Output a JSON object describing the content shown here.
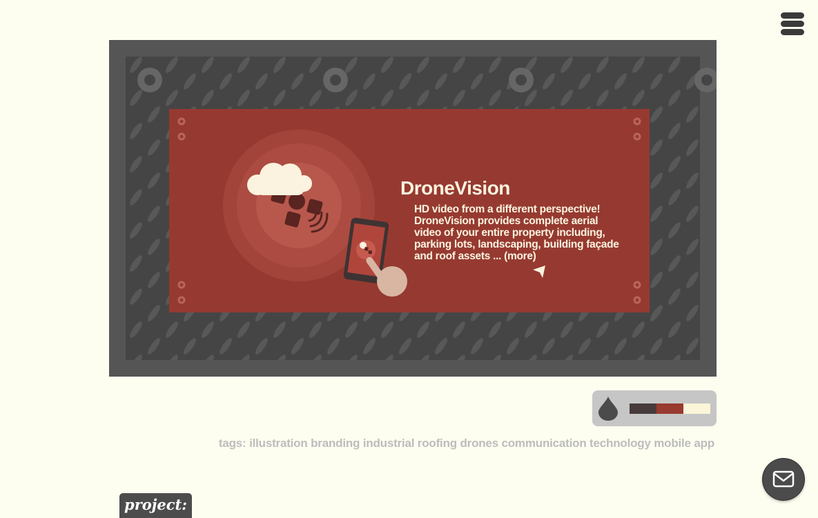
{
  "nav": {
    "menu_icon": "hamburger-icon"
  },
  "hero": {
    "title": "DroneVision",
    "description_lines": [
      "HD video from a different perspective!",
      "DroneVision provides complete aerial",
      "video of your entire property including,",
      "parking lots, landscaping, building façade",
      "and roof assets ... (more)"
    ],
    "colors": {
      "frame": "#555555",
      "plate": "#454545",
      "banner": "#963a31",
      "text": "#fbf3df"
    }
  },
  "palette": {
    "icon": "color-drop-icon",
    "swatches": [
      "#473c3b",
      "#983a2f",
      "#fbf5d9"
    ]
  },
  "tags": {
    "label": "tags:",
    "items": [
      "illustration",
      "branding",
      "industrial",
      "roofing",
      "drones",
      "communication",
      "technology",
      "mobile",
      "app"
    ]
  },
  "contact": {
    "icon": "mail-icon"
  },
  "project": {
    "label": "project:"
  }
}
